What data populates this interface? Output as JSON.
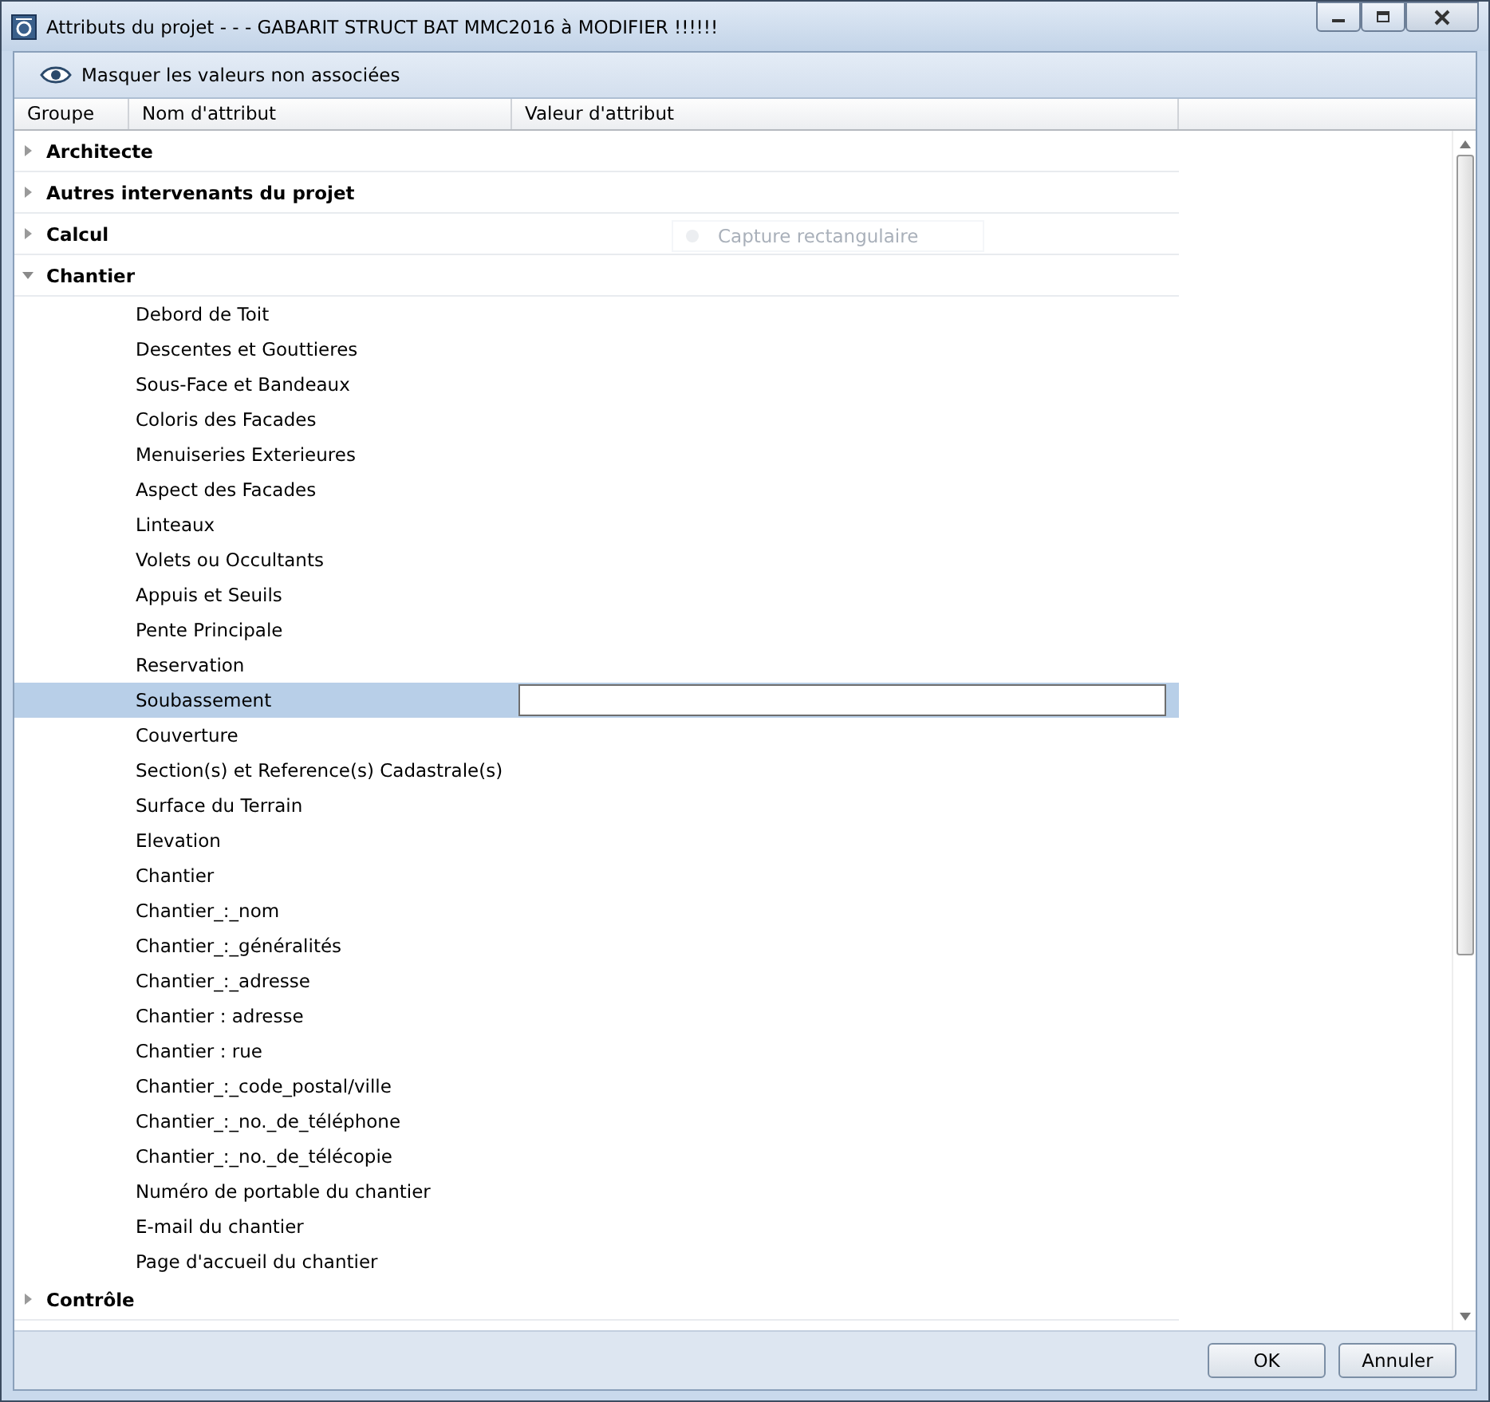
{
  "window": {
    "title": "Attributs du projet - - - GABARIT STRUCT BAT MMC2016 à MODIFIER !!!!!!"
  },
  "toolbar": {
    "toggle_label": "Masquer les valeurs non associées"
  },
  "columns": [
    "Groupe",
    "Nom d'attribut",
    "Valeur d'attribut"
  ],
  "overlay_hint": "Capture rectangulaire",
  "groups": [
    {
      "label": "Architecte",
      "expanded": false
    },
    {
      "label": "Autres intervenants du projet",
      "expanded": false
    },
    {
      "label": "Calcul",
      "expanded": false
    },
    {
      "label": "Chantier",
      "expanded": true,
      "children": [
        {
          "name": "Debord de Toit",
          "selected": false
        },
        {
          "name": "Descentes et Gouttieres",
          "selected": false
        },
        {
          "name": "Sous-Face et Bandeaux",
          "selected": false
        },
        {
          "name": "Coloris des Facades",
          "selected": false
        },
        {
          "name": "Menuiseries Exterieures",
          "selected": false
        },
        {
          "name": "Aspect des Facades",
          "selected": false
        },
        {
          "name": "Linteaux",
          "selected": false
        },
        {
          "name": "Volets ou Occultants",
          "selected": false
        },
        {
          "name": "Appuis et Seuils",
          "selected": false
        },
        {
          "name": "Pente Principale",
          "selected": false
        },
        {
          "name": "Reservation",
          "selected": false
        },
        {
          "name": "Soubassement",
          "selected": true
        },
        {
          "name": "Couverture",
          "selected": false
        },
        {
          "name": "Section(s) et Reference(s) Cadastrale(s)",
          "selected": false
        },
        {
          "name": "Surface du Terrain",
          "selected": false
        },
        {
          "name": "Elevation",
          "selected": false
        },
        {
          "name": "Chantier",
          "selected": false
        },
        {
          "name": "Chantier_:_nom",
          "selected": false
        },
        {
          "name": "Chantier_:_généralités",
          "selected": false
        },
        {
          "name": "Chantier_:_adresse",
          "selected": false
        },
        {
          "name": "Chantier : adresse",
          "selected": false
        },
        {
          "name": "Chantier : rue",
          "selected": false
        },
        {
          "name": "Chantier_:_code_postal/ville",
          "selected": false
        },
        {
          "name": "Chantier_:_no._de_téléphone",
          "selected": false
        },
        {
          "name": "Chantier_:_no._de_télécopie",
          "selected": false
        },
        {
          "name": "Numéro de portable du chantier",
          "selected": false
        },
        {
          "name": "E-mail du chantier",
          "selected": false
        },
        {
          "name": "Page d'accueil du chantier",
          "selected": false
        }
      ]
    },
    {
      "label": "Contrôle",
      "expanded": false
    }
  ],
  "buttons": [
    "OK",
    "Annuler"
  ]
}
